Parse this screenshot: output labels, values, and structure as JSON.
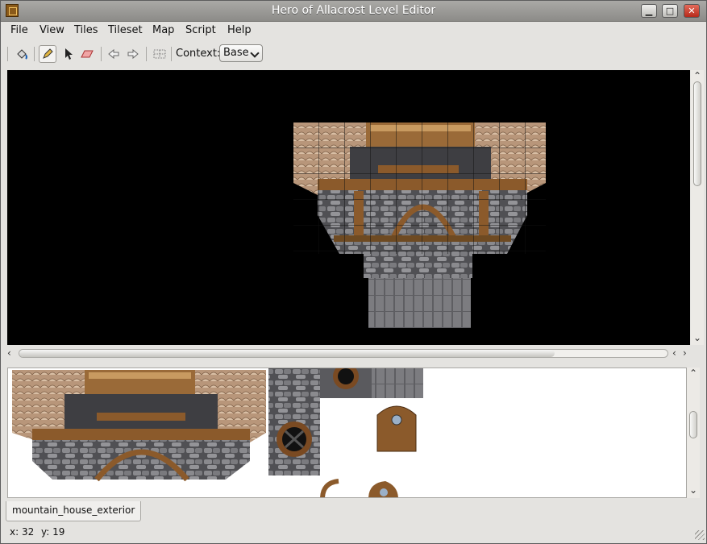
{
  "window": {
    "title": "Hero of Allacrost Level Editor"
  },
  "menu": [
    "File",
    "View",
    "Tiles",
    "Tileset",
    "Map",
    "Script",
    "Help"
  ],
  "toolbar": {
    "context_label": "Context:",
    "context_value": "Base"
  },
  "tileset_tab": {
    "label": "mountain_house_exterior"
  },
  "status": {
    "x_label": "x: 32",
    "y_label": "y: 19"
  },
  "colors": {
    "titlebar": "#9a9996",
    "canvas": "#000000",
    "wood": "#8b5a2b",
    "stone": "#6e6e70",
    "thatch": "#b49070"
  }
}
